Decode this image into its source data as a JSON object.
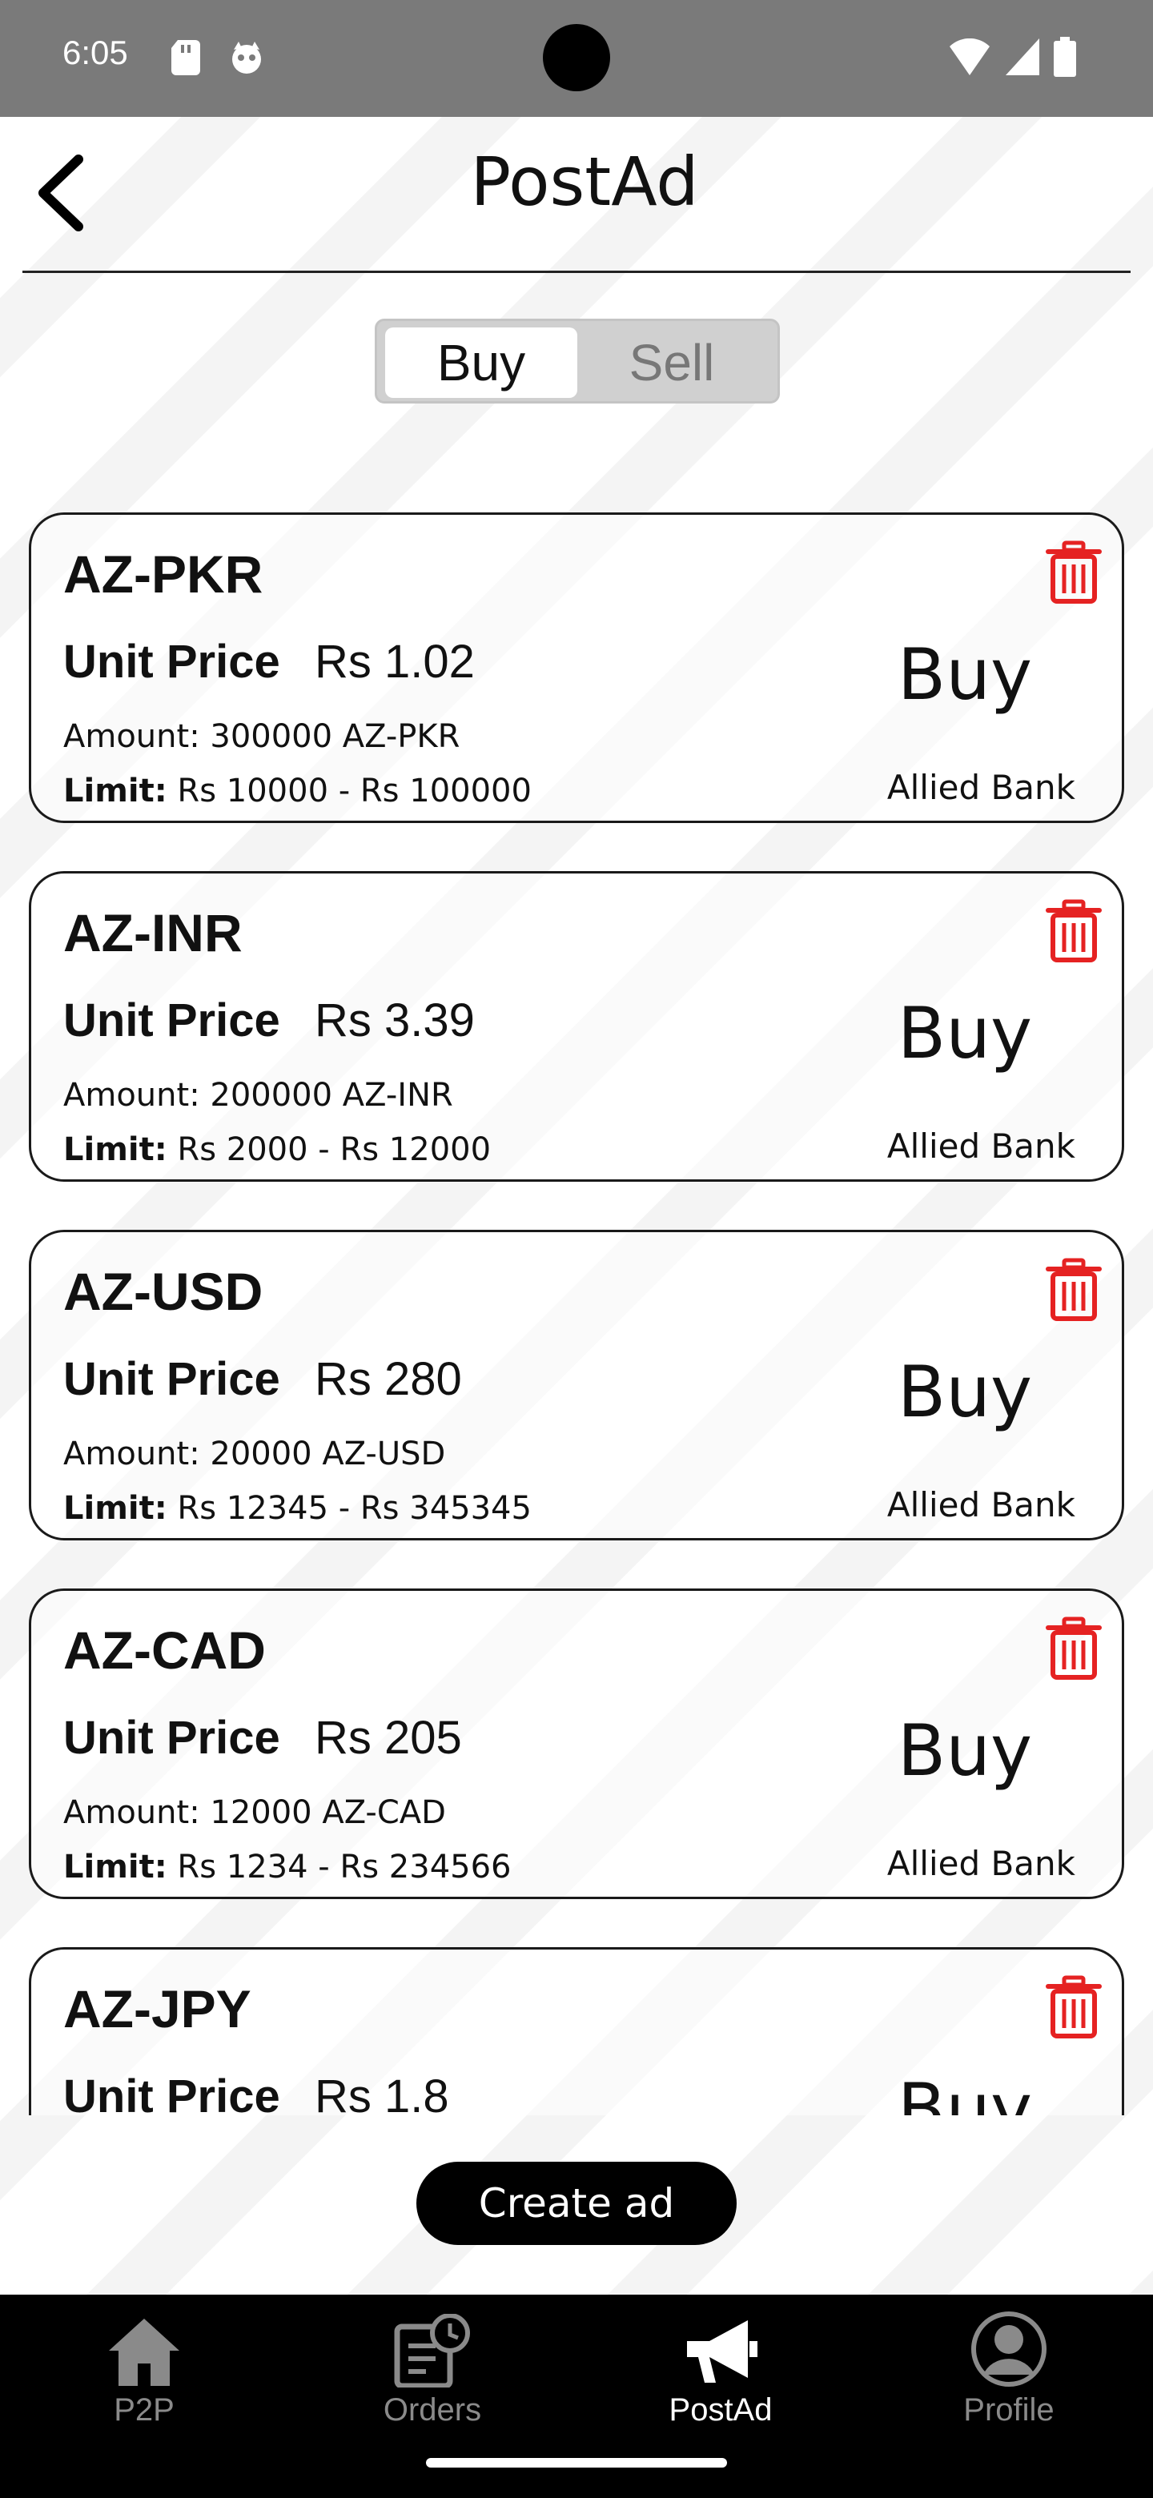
{
  "status_bar": {
    "time": "6:05"
  },
  "header": {
    "title": "PostAd"
  },
  "toggle": {
    "buy_label": "Buy",
    "sell_label": "Sell",
    "selected": "Buy"
  },
  "ads": [
    {
      "pair": "AZ-PKR",
      "unit_label": "Unit Price",
      "unit_value": "Rs 1.02",
      "amount": "Amount: 300000 AZ-PKR",
      "limit_label": "Limit:",
      "limit_value": " Rs 10000 - Rs 100000",
      "action": "Buy",
      "bank": "Allied Bank"
    },
    {
      "pair": "AZ-INR",
      "unit_label": "Unit Price",
      "unit_value": "Rs 3.39",
      "amount": "Amount: 200000 AZ-INR",
      "limit_label": "Limit:",
      "limit_value": " Rs 2000 - Rs 12000",
      "action": "Buy",
      "bank": "Allied Bank"
    },
    {
      "pair": "AZ-USD",
      "unit_label": "Unit Price",
      "unit_value": "Rs 280",
      "amount": "Amount: 20000 AZ-USD",
      "limit_label": "Limit:",
      "limit_value": " Rs 12345 - Rs 345345",
      "action": "Buy",
      "bank": "Allied Bank"
    },
    {
      "pair": "AZ-CAD",
      "unit_label": "Unit Price",
      "unit_value": "Rs 205",
      "amount": "Amount: 12000 AZ-CAD",
      "limit_label": "Limit:",
      "limit_value": " Rs 1234 - Rs 234566",
      "action": "Buy",
      "bank": "Allied Bank"
    },
    {
      "pair": "AZ-JPY",
      "unit_label": "Unit Price",
      "unit_value": "Rs 1.8",
      "amount": "",
      "limit_label": "",
      "limit_value": "",
      "action": "Buy",
      "bank": ""
    }
  ],
  "create_ad": {
    "label": "Create ad"
  },
  "bottom_nav": {
    "items": [
      {
        "label": "P2P",
        "icon": "home-icon"
      },
      {
        "label": "Orders",
        "icon": "orders-icon"
      },
      {
        "label": "PostAd",
        "icon": "megaphone-icon",
        "active": true
      },
      {
        "label": "Profile",
        "icon": "profile-icon"
      }
    ]
  },
  "colors": {
    "accent": "#000000",
    "delete": "#e52222",
    "status_bar": "#7a7a7a"
  }
}
